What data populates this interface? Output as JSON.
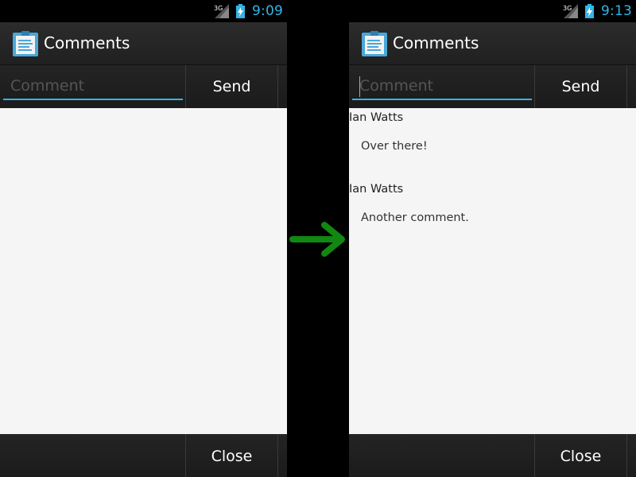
{
  "status_icons": {
    "signal": "3g-signal-icon",
    "battery": "battery-charging-icon"
  },
  "colors": {
    "accent": "#33b5e5",
    "arrow": "#118811",
    "list_bg": "#f5f5f5"
  },
  "before": {
    "status_bar": {
      "network": "3G",
      "time": "9:09"
    },
    "action_bar": {
      "title": "Comments",
      "icon": "clipboard-icon"
    },
    "compose": {
      "placeholder": "Comment",
      "send_label": "Send"
    },
    "footer": {
      "close_label": "Close"
    },
    "comments": []
  },
  "after": {
    "status_bar": {
      "network": "3G",
      "time": "9:13"
    },
    "action_bar": {
      "title": "Comments",
      "icon": "clipboard-icon"
    },
    "compose": {
      "placeholder": "Comment",
      "send_label": "Send"
    },
    "footer": {
      "close_label": "Close"
    },
    "comments": [
      {
        "author": "Ian Watts",
        "text": "Over there!"
      },
      {
        "author": "Ian Watts",
        "text": "Another comment."
      }
    ]
  },
  "transition_icon": "right-arrow-icon"
}
